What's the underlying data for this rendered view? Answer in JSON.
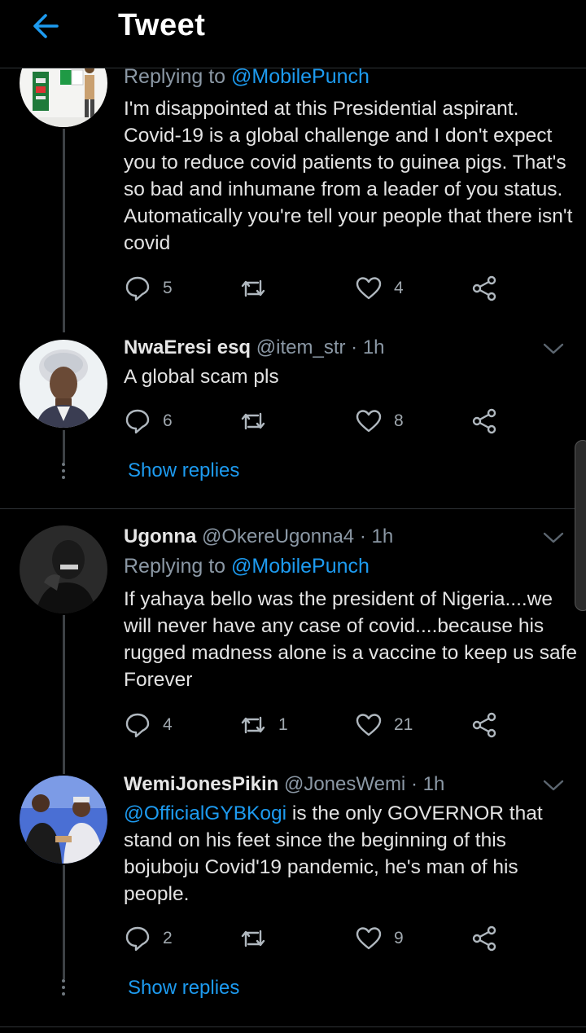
{
  "header": {
    "title": "Tweet",
    "back_icon": "arrow-left-icon",
    "accent": "#1d9bf0"
  },
  "tweets": [
    {
      "reply_prefix": "Replying to ",
      "reply_handle": "@MobilePunch",
      "text": "I'm disappointed at this Presidential aspirant. Covid-19 is a global challenge and I don't expect you to reduce covid patients to guinea pigs. That's so bad and inhumane from a leader of you status. Automatically you're tell your people that there isn't covid",
      "replies": "5",
      "retweets": "",
      "likes": "4"
    },
    {
      "name": "NwaEresi esq",
      "handle": "@item_str",
      "time": "· 1h",
      "text": "A global scam pls",
      "replies": "6",
      "retweets": "",
      "likes": "8",
      "show_replies": "Show replies"
    },
    {
      "name": "Ugonna",
      "handle": "@OkereUgonna4",
      "time": "· 1h",
      "reply_prefix": "Replying to ",
      "reply_handle": "@MobilePunch",
      "text": "If yahaya bello was the president of Nigeria....we will never have any case of covid....because his rugged madness alone is a vaccine to keep us safe Forever",
      "replies": "4",
      "retweets": "1",
      "likes": "21"
    },
    {
      "name": "WemiJonesPikin",
      "handle": "@JonesWemi",
      "time": "· 1h",
      "mention": "@OfficialGYBKogi",
      "text": " is the only GOVERNOR that stand on his feet since the beginning of this bojuboju Covid'19 pandemic, he's man of his people.",
      "replies": "2",
      "retweets": "",
      "likes": "9",
      "show_replies": "Show replies"
    }
  ]
}
